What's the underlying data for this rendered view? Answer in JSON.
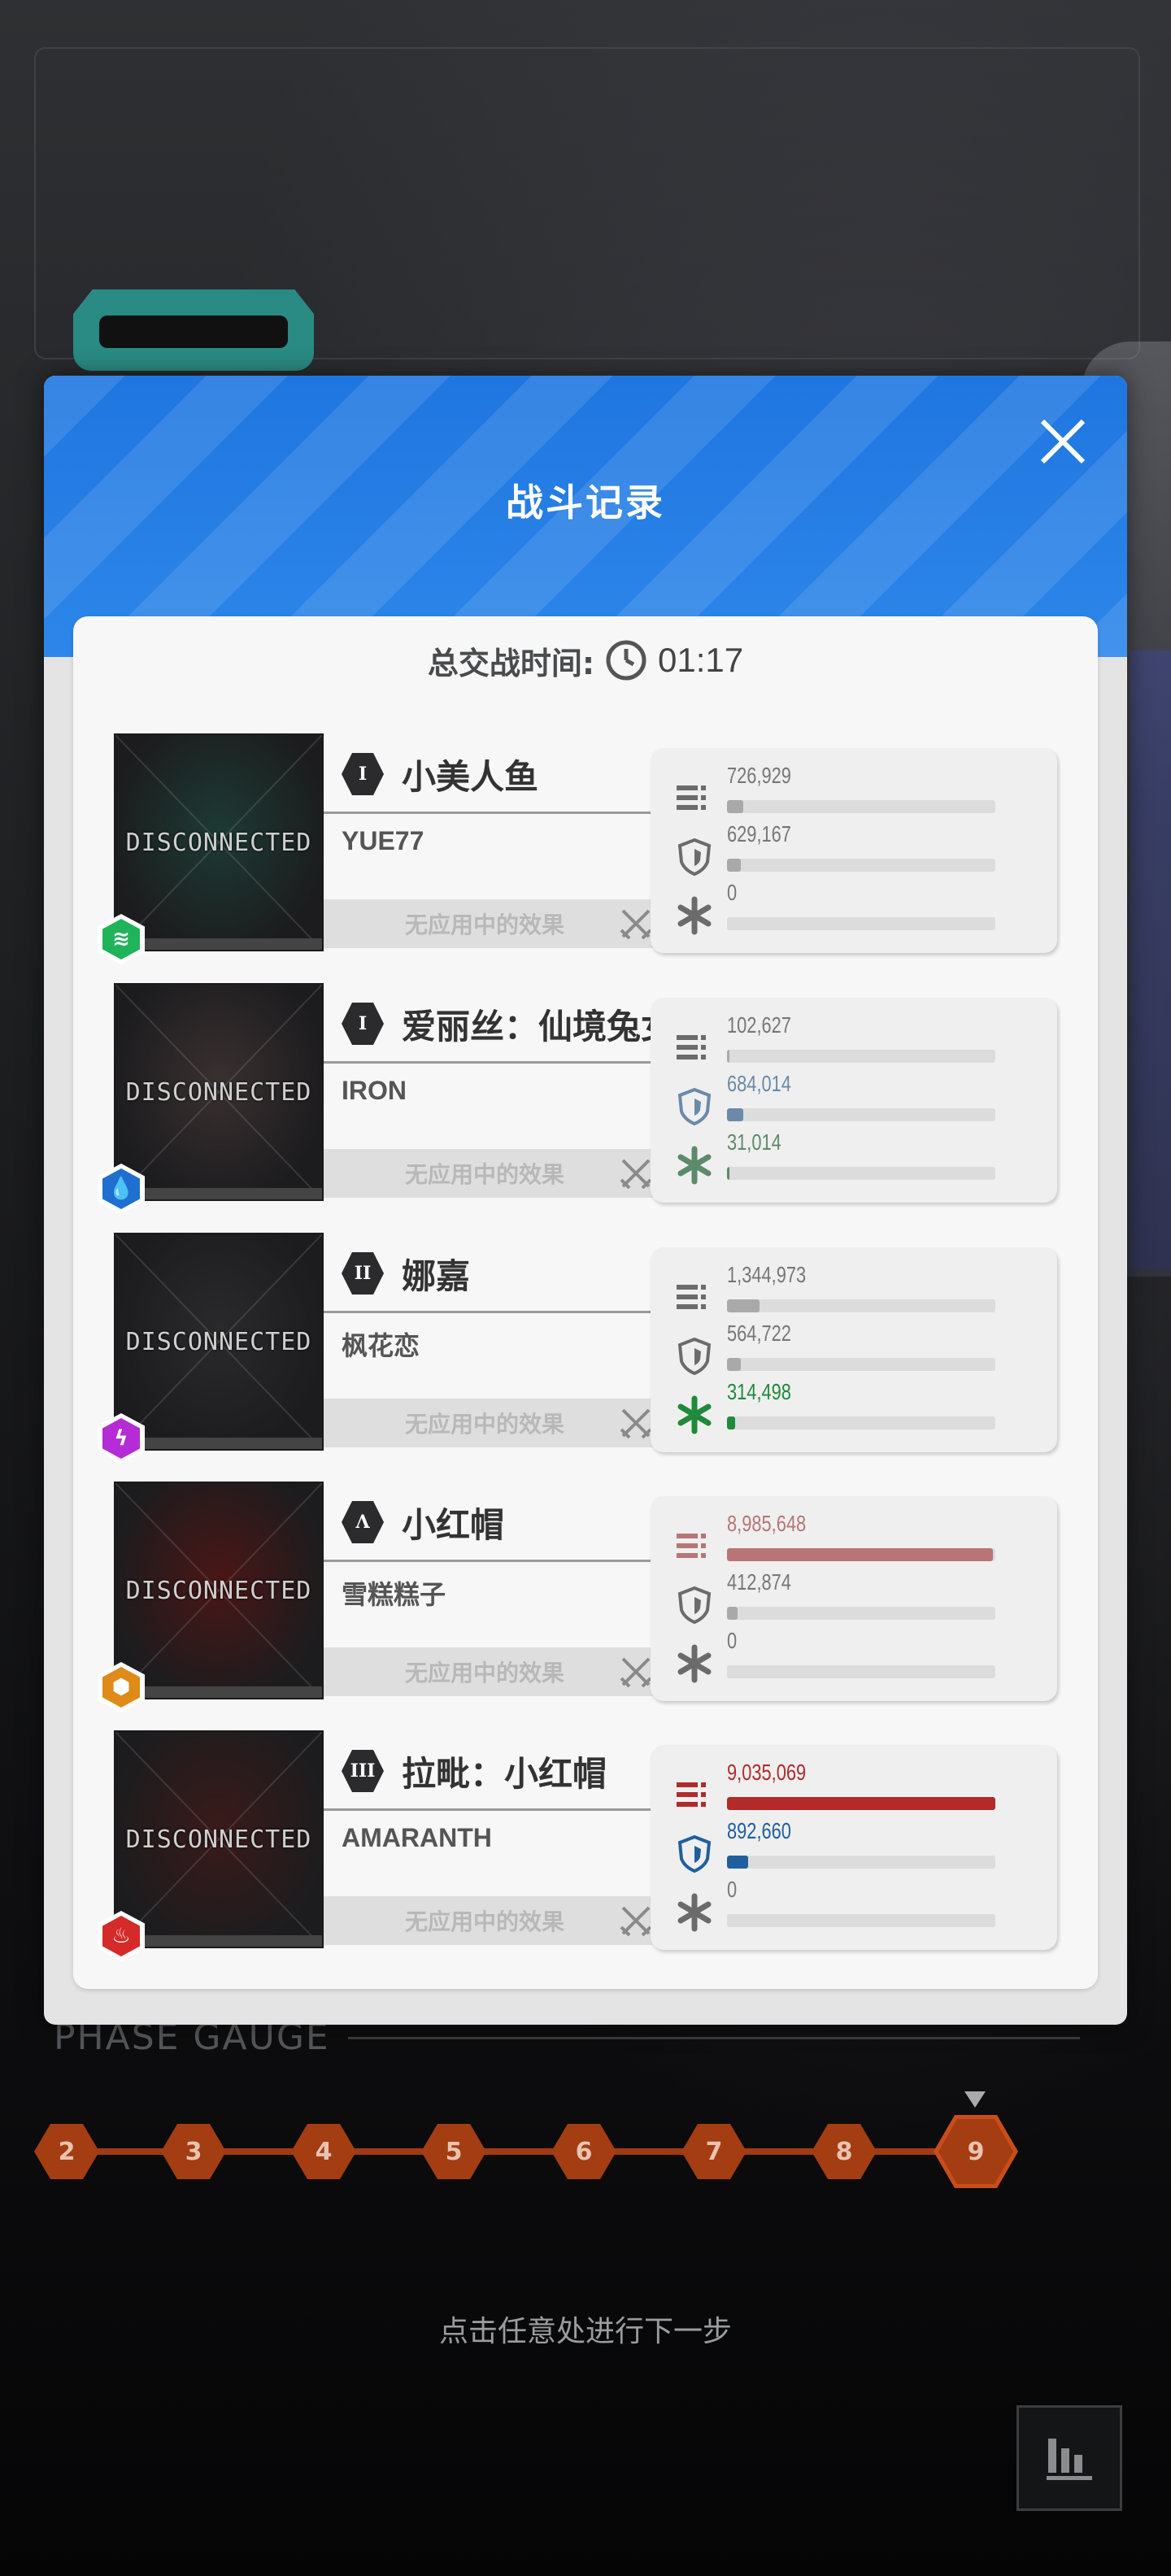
{
  "modal": {
    "title": "战斗记录",
    "total_time_label": "总交战时间:",
    "total_time_value": "01:17"
  },
  "players": [
    {
      "burst": "I",
      "character": "小美人鱼",
      "player": "YUE77",
      "status": "DISCONNECTED",
      "element": "wind",
      "element_color": "#1fb35a",
      "effect": "无应用中的效果",
      "damage": "726,929",
      "damage_pct": 6,
      "damage_color": "#a9a9a9",
      "shield": "629,167",
      "shield_pct": 5,
      "shield_color": "#a9a9a9",
      "heal": "0",
      "heal_pct": 0,
      "heal_color": "#a9a9a9",
      "avatar_tint": "#1d3a34"
    },
    {
      "burst": "I",
      "character": "爱丽丝：仙境兔女",
      "player": "IRON",
      "status": "DISCONNECTED",
      "element": "water",
      "element_color": "#1f6fd0",
      "effect": "无应用中的效果",
      "damage": "102,627",
      "damage_pct": 1,
      "damage_color": "#a9a9a9",
      "shield": "684,014",
      "shield_pct": 6,
      "shield_color": "#6a8aa8",
      "heal": "31,014",
      "heal_pct": 1,
      "heal_color": "#5c8a6a",
      "avatar_tint": "#3a3030"
    },
    {
      "burst": "II",
      "character": "娜嘉",
      "player": "枫花恋",
      "status": "DISCONNECTED",
      "element": "electric",
      "element_color": "#b52bd6",
      "effect": "无应用中的效果",
      "damage": "1,344,973",
      "damage_pct": 12,
      "damage_color": "#a9a9a9",
      "shield": "564,722",
      "shield_pct": 5,
      "shield_color": "#a9a9a9",
      "heal": "314,498",
      "heal_pct": 3,
      "heal_color": "#1f8a3a",
      "avatar_tint": "#2a2a2c"
    },
    {
      "burst": "Λ",
      "character": "小红帽",
      "player": "雪糕糕子",
      "status": "DISCONNECTED",
      "element": "iron",
      "element_color": "#e08a1a",
      "effect": "无应用中的效果",
      "damage": "8,985,648",
      "damage_pct": 99,
      "damage_color": "#b97575",
      "shield": "412,874",
      "shield_pct": 4,
      "shield_color": "#a9a9a9",
      "heal": "0",
      "heal_pct": 0,
      "heal_color": "#a9a9a9",
      "avatar_tint": "#4a1616"
    },
    {
      "burst": "III",
      "character": "拉毗：小红帽",
      "player": "AMARANTH",
      "status": "DISCONNECTED",
      "element": "fire",
      "element_color": "#d42a2a",
      "effect": "无应用中的效果",
      "damage": "9,035,069",
      "damage_pct": 100,
      "damage_color": "#b22a2a",
      "shield": "892,660",
      "shield_pct": 8,
      "shield_color": "#1f5fa0",
      "heal": "0",
      "heal_pct": 0,
      "heal_color": "#a9a9a9",
      "avatar_tint": "#3a1a1a"
    }
  ],
  "phase_gauge": {
    "title": "PHASE GAUGE",
    "nodes": [
      "2",
      "3",
      "4",
      "5",
      "6",
      "7",
      "8",
      "9"
    ],
    "current": "9"
  },
  "hint": "点击任意处进行下一步"
}
